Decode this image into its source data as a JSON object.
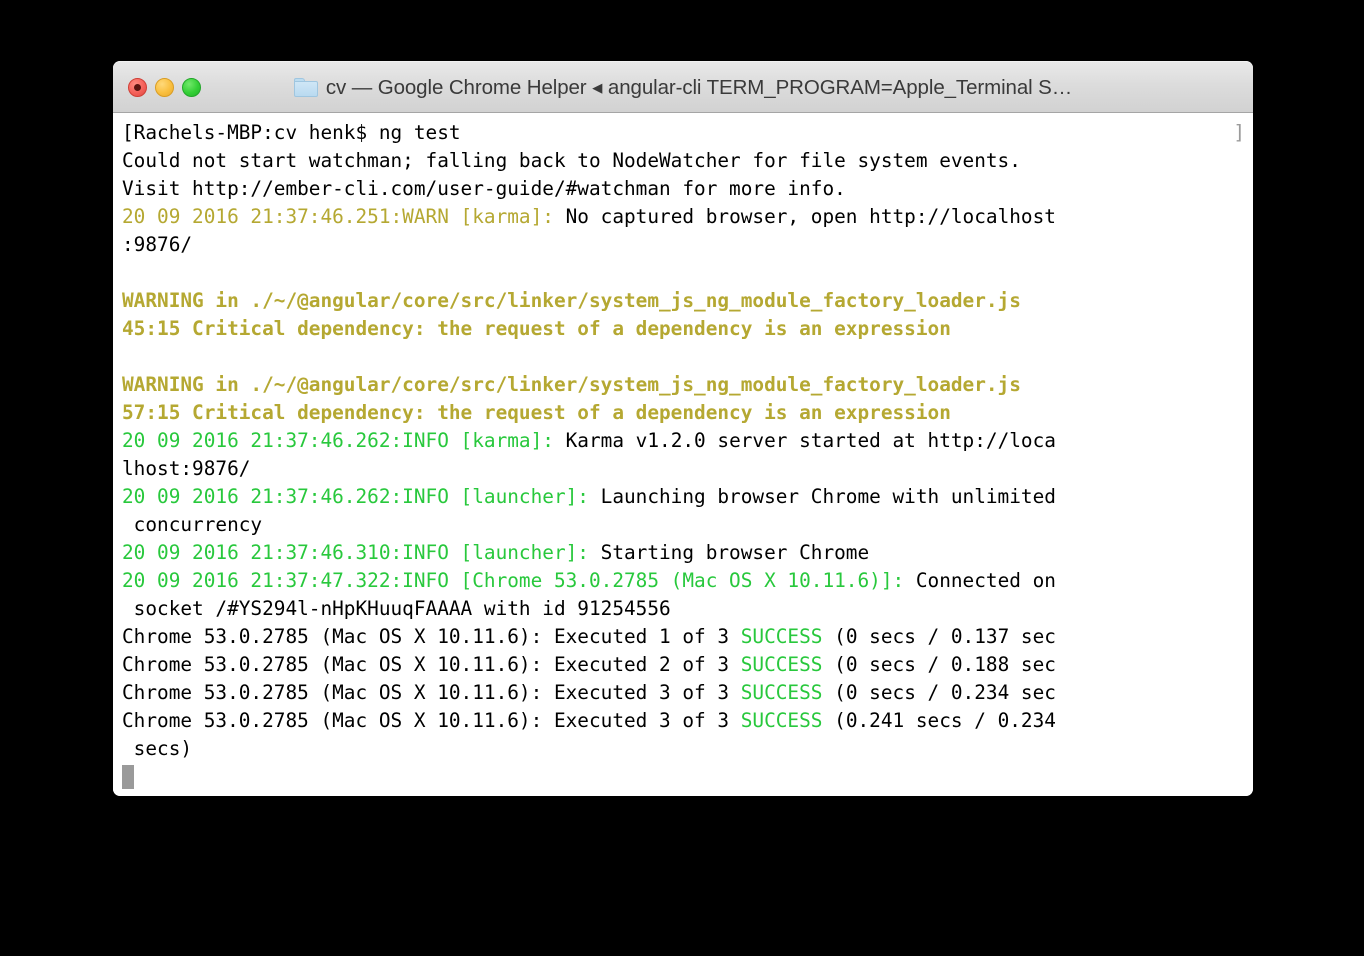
{
  "window": {
    "title": "cv — Google Chrome Helper ◂ angular-cli TERM_PROGRAM=Apple_Terminal S…",
    "folder_icon": "folder-icon",
    "controls": {
      "close": "close-button",
      "minimize": "minimize-button",
      "zoom": "zoom-button"
    }
  },
  "terminal": {
    "prompt_mark": "]",
    "cursor": "block-cursor",
    "colors": {
      "background": "#ffffff",
      "foreground": "#000000",
      "warn": "#b5a832",
      "info": "#28c83c",
      "success": "#28c83c",
      "cursor": "#9a9a9a",
      "prompt_mark": "#9b9b9b"
    },
    "lines": [
      {
        "id": "prompt-command",
        "segments": [
          {
            "text": "[Rachels-MBP:cv henk$ ng test",
            "style": "plain"
          }
        ]
      },
      {
        "id": "watchman-warning",
        "segments": [
          {
            "text": "Could not start watchman; falling back to NodeWatcher for file system events.",
            "style": "plain"
          }
        ]
      },
      {
        "id": "watchman-visit",
        "segments": [
          {
            "text": "Visit http://ember-cli.com/user-guide/#watchman for more info.",
            "style": "plain"
          }
        ]
      },
      {
        "id": "karma-no-browser",
        "segments": [
          {
            "text": "20 09 2016 21:37:46.251:WARN [karma]: ",
            "style": "warn"
          },
          {
            "text": "No captured browser, open http://localhost",
            "style": "plain"
          }
        ]
      },
      {
        "id": "karma-no-browser-wrap",
        "segments": [
          {
            "text": ":9876/",
            "style": "plain"
          }
        ]
      },
      {
        "id": "blank-1",
        "segments": [
          {
            "text": " ",
            "style": "plain"
          }
        ]
      },
      {
        "id": "warning-1-head",
        "segments": [
          {
            "text": "WARNING in ./~/@angular/core/src/linker/system_js_ng_module_factory_loader.js",
            "style": "bwarn"
          }
        ]
      },
      {
        "id": "warning-1-detail",
        "segments": [
          {
            "text": "45:15 Critical dependency: the request of a dependency is an expression",
            "style": "bwarn"
          }
        ]
      },
      {
        "id": "blank-2",
        "segments": [
          {
            "text": " ",
            "style": "plain"
          }
        ]
      },
      {
        "id": "warning-2-head",
        "segments": [
          {
            "text": "WARNING in ./~/@angular/core/src/linker/system_js_ng_module_factory_loader.js",
            "style": "bwarn"
          }
        ]
      },
      {
        "id": "warning-2-detail",
        "segments": [
          {
            "text": "57:15 Critical dependency: the request of a dependency is an expression",
            "style": "bwarn"
          }
        ]
      },
      {
        "id": "karma-server",
        "segments": [
          {
            "text": "20 09 2016 21:37:46.262:INFO [karma]: ",
            "style": "info"
          },
          {
            "text": "Karma v1.2.0 server started at http://loca",
            "style": "plain"
          }
        ]
      },
      {
        "id": "karma-server-wrap",
        "segments": [
          {
            "text": "lhost:9876/",
            "style": "plain"
          }
        ]
      },
      {
        "id": "launcher-launching",
        "segments": [
          {
            "text": "20 09 2016 21:37:46.262:INFO [launcher]: ",
            "style": "info"
          },
          {
            "text": "Launching browser Chrome with unlimited",
            "style": "plain"
          }
        ]
      },
      {
        "id": "launcher-launching-wrap",
        "segments": [
          {
            "text": " concurrency",
            "style": "plain"
          }
        ]
      },
      {
        "id": "launcher-starting",
        "segments": [
          {
            "text": "20 09 2016 21:37:46.310:INFO [launcher]: ",
            "style": "info"
          },
          {
            "text": "Starting browser Chrome",
            "style": "plain"
          }
        ]
      },
      {
        "id": "chrome-connected",
        "segments": [
          {
            "text": "20 09 2016 21:37:47.322:INFO [Chrome 53.0.2785 (Mac OS X 10.11.6)]: ",
            "style": "info"
          },
          {
            "text": "Connected on",
            "style": "plain"
          }
        ]
      },
      {
        "id": "chrome-connected-wrap",
        "segments": [
          {
            "text": " socket /#YS294l-nHpKHuuqFAAAA with id 91254556",
            "style": "plain"
          }
        ]
      },
      {
        "id": "exec-1",
        "segments": [
          {
            "text": "Chrome 53.0.2785 (Mac OS X 10.11.6): Executed 1 of 3 ",
            "style": "plain"
          },
          {
            "text": "SUCCESS",
            "style": "ok"
          },
          {
            "text": " (0 secs / 0.137 sec",
            "style": "plain"
          }
        ]
      },
      {
        "id": "exec-2",
        "segments": [
          {
            "text": "Chrome 53.0.2785 (Mac OS X 10.11.6): Executed 2 of 3 ",
            "style": "plain"
          },
          {
            "text": "SUCCESS",
            "style": "ok"
          },
          {
            "text": " (0 secs / 0.188 sec",
            "style": "plain"
          }
        ]
      },
      {
        "id": "exec-3",
        "segments": [
          {
            "text": "Chrome 53.0.2785 (Mac OS X 10.11.6): Executed 3 of 3 ",
            "style": "plain"
          },
          {
            "text": "SUCCESS",
            "style": "ok"
          },
          {
            "text": " (0 secs / 0.234 sec",
            "style": "plain"
          }
        ]
      },
      {
        "id": "exec-total",
        "segments": [
          {
            "text": "Chrome 53.0.2785 (Mac OS X 10.11.6): Executed 3 of 3 ",
            "style": "plain"
          },
          {
            "text": "SUCCESS",
            "style": "ok"
          },
          {
            "text": " (0.241 secs / 0.234",
            "style": "plain"
          }
        ]
      },
      {
        "id": "exec-total-wrap",
        "segments": [
          {
            "text": " secs)",
            "style": "plain"
          }
        ]
      }
    ]
  }
}
